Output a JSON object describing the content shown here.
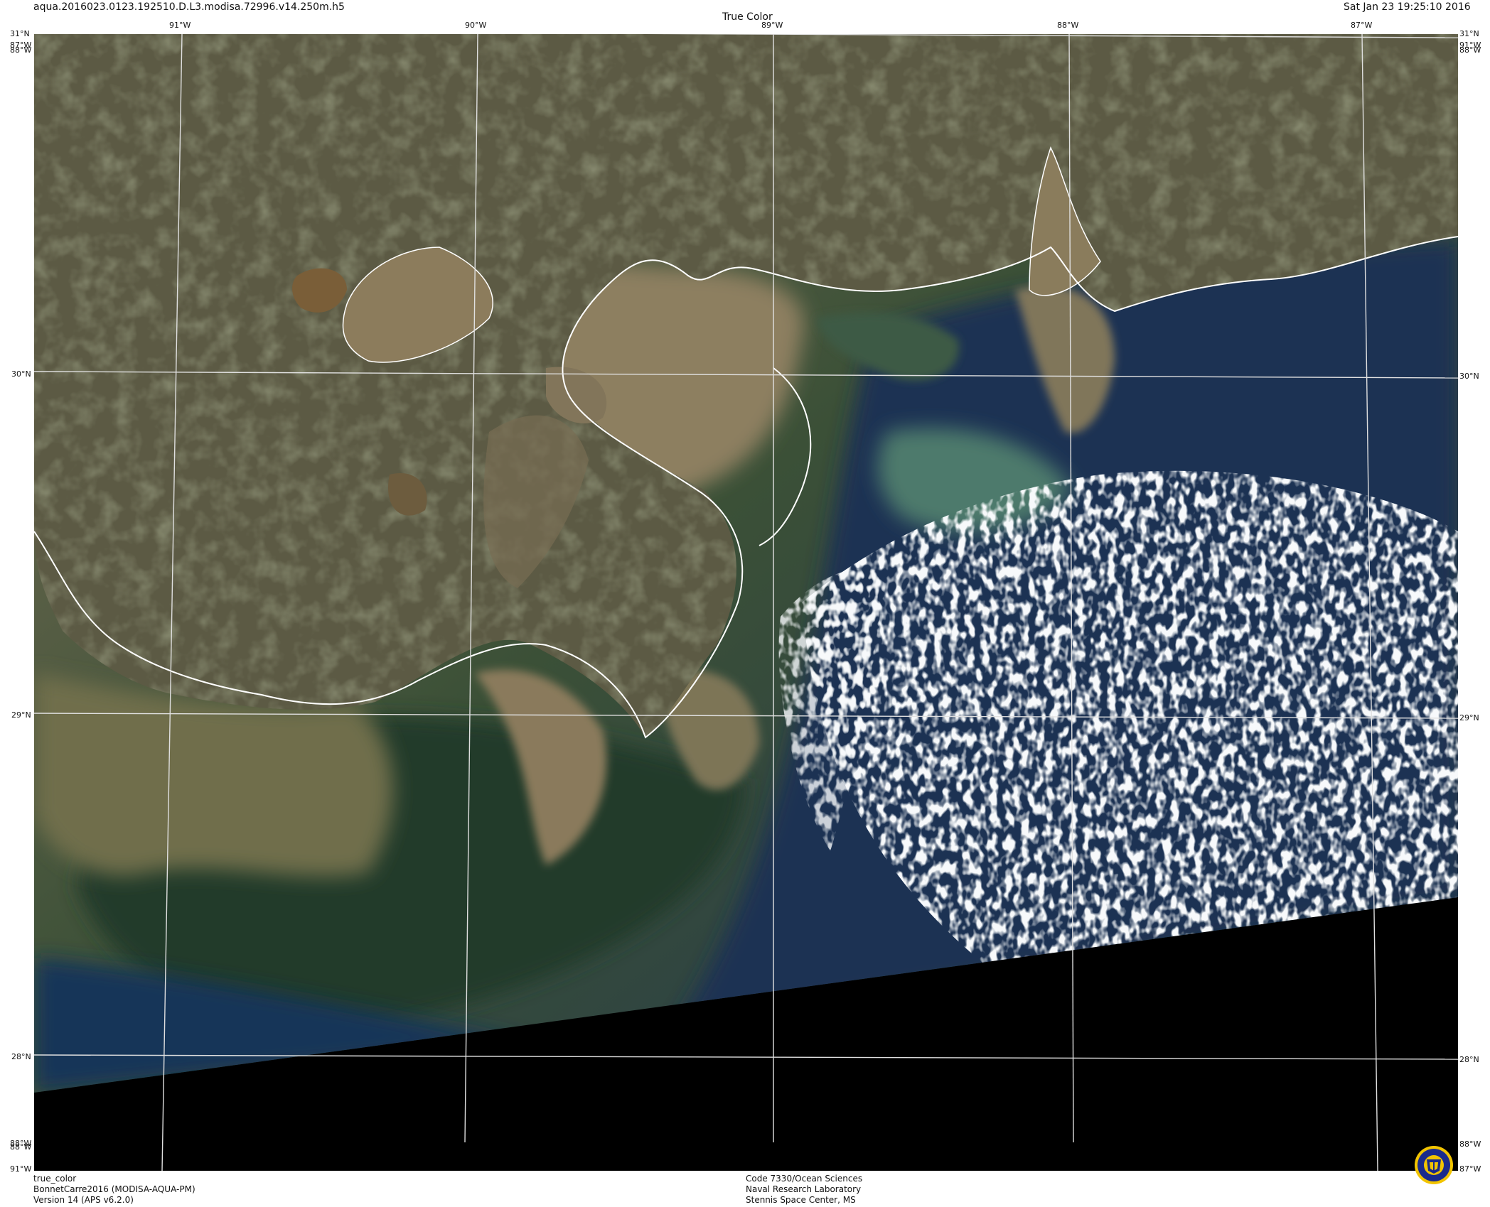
{
  "header": {
    "filename": "aqua.2016023.0123.192510.D.L3.modisa.72996.v14.250m.h5",
    "product": "True Color",
    "datetime": "Sat Jan 23 19:25:10 2016"
  },
  "map": {
    "top_lon_labels": [
      "91°W",
      "90°W",
      "89°W",
      "88°W",
      "87°W"
    ],
    "lat_labels": [
      "31°N",
      "30°N",
      "29°N",
      "28°N"
    ],
    "corner_labels": {
      "top_left_lat": "31°N",
      "top_left_lon": "88°W",
      "top_left_lon_alt": "87°W",
      "top_right_lat": "31°N",
      "top_right_lon": "88°W",
      "top_right_lon_alt": "91°W",
      "bottom_left_lon": "88°W",
      "bottom_left_lon_alt": "91°W",
      "bottom_right_lon": "88°W",
      "bottom_right_lon_alt": "87°W"
    },
    "colors": {
      "land": "#5c5a44",
      "sediment_water": "#8a7c5e",
      "green_water": "#2f4a33",
      "deep_water": "#1a2f4f",
      "cloud": "#e8ecef",
      "no_data": "#000000",
      "grid": "#e0e0e0",
      "coastline": "#ffffff"
    }
  },
  "footer": {
    "left_line1": "true_color",
    "left_line2": "BonnetCarre2016 (MODISA-AQUA-PM)",
    "left_line3": "Version 14 (APS v6.2.0)",
    "center_line1": "Code 7330/Ocean Sciences",
    "center_line2": "Naval Research Laboratory",
    "center_line3": "Stennis Space Center, MS"
  }
}
